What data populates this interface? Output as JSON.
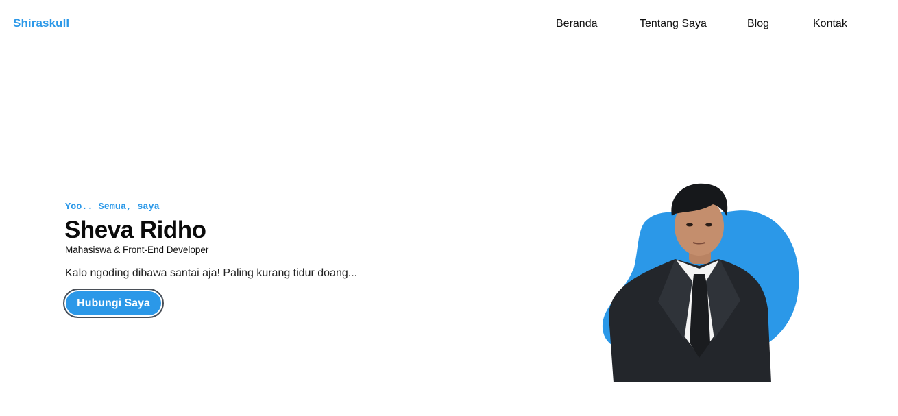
{
  "navbar": {
    "brand": "Shiraskull",
    "links": [
      {
        "label": "Beranda"
      },
      {
        "label": "Tentang Saya"
      },
      {
        "label": "Blog"
      },
      {
        "label": "Kontak"
      }
    ]
  },
  "hero": {
    "greeting": "Yoo.. Semua, saya",
    "name": "Sheva Ridho",
    "role": "Mahasiswa & Front-End Developer",
    "tagline": "Kalo ngoding dibawa santai aja! Paling kurang tidur doang...",
    "cta_label": "Hubungi Saya",
    "portrait_icon": "person-portrait"
  },
  "colors": {
    "accent": "#2b98e8",
    "text": "#111111",
    "background": "#ffffff"
  }
}
